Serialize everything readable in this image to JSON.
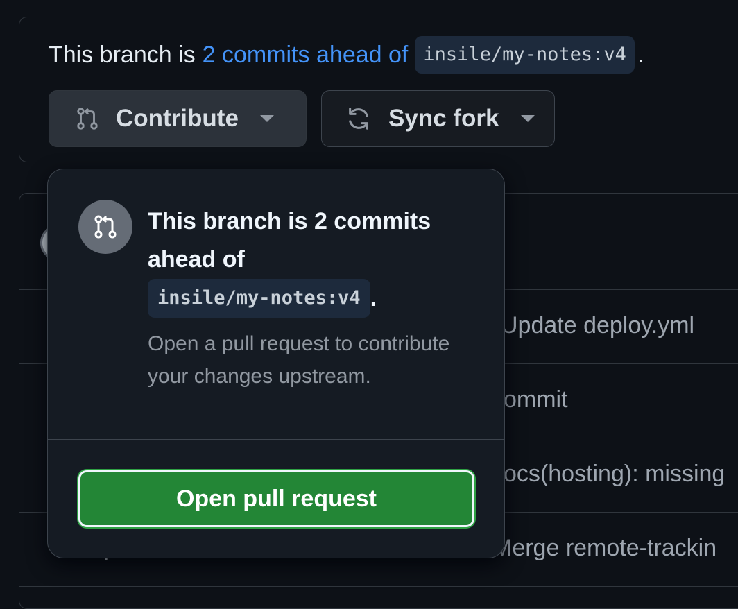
{
  "branch_status": {
    "prefix": "This branch is",
    "link_text": "2 commits ahead of",
    "ref": "insile/my-notes:v4",
    "suffix": "."
  },
  "buttons": {
    "contribute_label": "Contribute",
    "sync_label": "Sync fork"
  },
  "file_rows": [
    {
      "name": "",
      "commit": "Update deploy.yml"
    },
    {
      "name": "",
      "commit": "ommit"
    },
    {
      "name": "",
      "commit": "ocs(hosting): missing"
    },
    {
      "name": "quartz",
      "commit": "Merge remote-trackin"
    }
  ],
  "popover": {
    "title": "This branch is 2 commits ahead of",
    "ref": "insile/my-notes:v4",
    "ref_suffix": ".",
    "description": "Open a pull request to contribute your changes upstream.",
    "button_label": "Open pull request"
  },
  "icons": {
    "contribute": "git-pull-request-icon",
    "sync": "sync-icon",
    "dropdown": "triangle-down-icon"
  },
  "colors": {
    "link": "#4493f8",
    "primary_button": "#238636",
    "page_background": "#0d1117",
    "popover_background": "#151b23"
  }
}
